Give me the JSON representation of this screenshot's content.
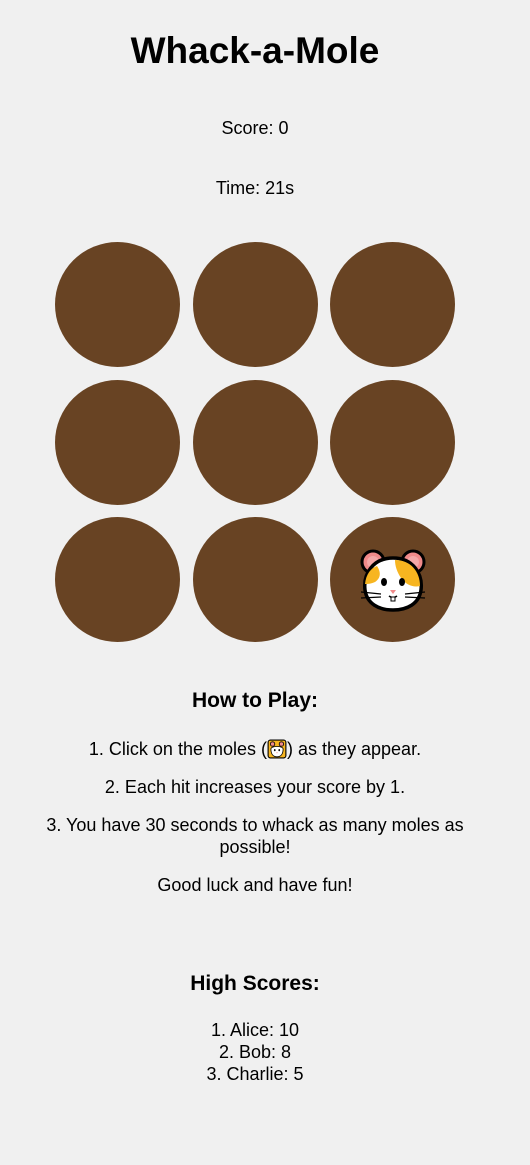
{
  "title": "Whack-a-Mole",
  "score_text": "Score: 0",
  "time_text": "Time: 21s",
  "holes": [
    {
      "mole": false
    },
    {
      "mole": false
    },
    {
      "mole": false
    },
    {
      "mole": false
    },
    {
      "mole": false
    },
    {
      "mole": false
    },
    {
      "mole": false
    },
    {
      "mole": false
    },
    {
      "mole": true,
      "icon": "hamster-face-icon"
    }
  ],
  "colors": {
    "background": "#f0f0f0",
    "hole": "#684323",
    "mole_fur": "#ffffff",
    "mole_patch": "#f7b520",
    "mole_ear": "#f08a8a"
  },
  "how_to_play": {
    "title": "How to Play:",
    "rule1_before": "1. Click on the moles (",
    "rule1_after": ") as they appear.",
    "rule2": "2. Each hit increases your score by 1.",
    "rule3": "3. You have 30 seconds to whack as many moles as possible!",
    "closing": "Good luck and have fun!"
  },
  "high_scores": {
    "title": "High Scores:",
    "entries": [
      "1. Alice: 10",
      "2. Bob: 8",
      "3. Charlie: 5"
    ]
  }
}
